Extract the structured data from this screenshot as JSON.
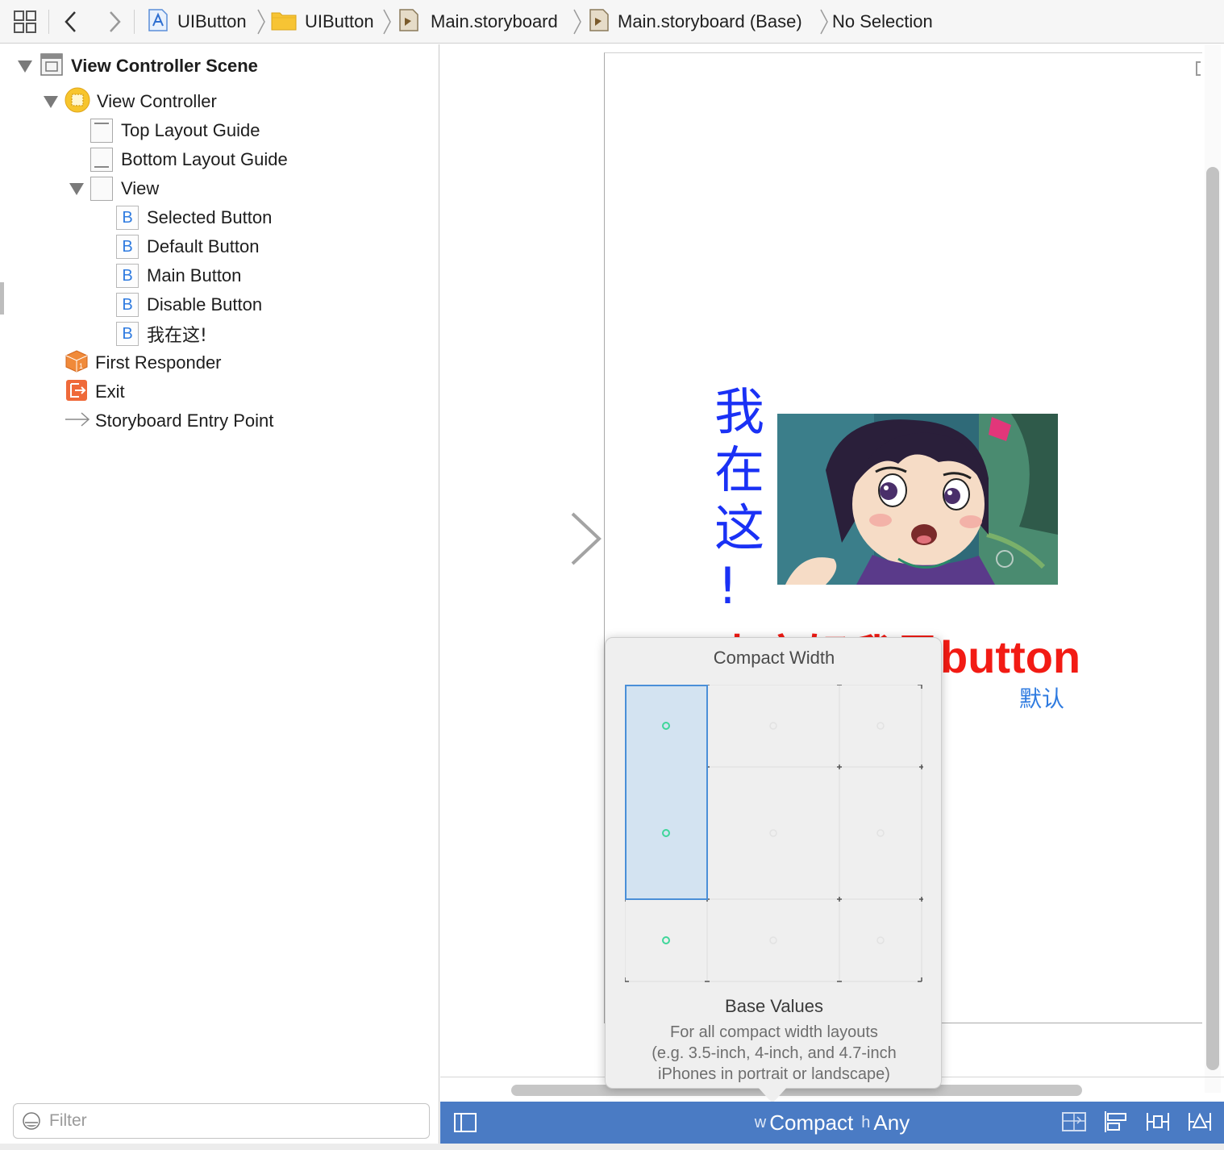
{
  "jumpbar": {
    "crumbs": [
      {
        "label": "UIButton",
        "icon": "app-project-icon"
      },
      {
        "label": "UIButton",
        "icon": "folder-icon"
      },
      {
        "label": "Main.storyboard",
        "icon": "storyboard-file-icon"
      },
      {
        "label": "Main.storyboard (Base)",
        "icon": "storyboard-file-icon"
      },
      {
        "label": "No Selection",
        "icon": ""
      }
    ]
  },
  "outline": {
    "scene": "View Controller Scene",
    "view_controller": "View Controller",
    "top_layout_guide": "Top Layout Guide",
    "bottom_layout_guide": "Bottom Layout Guide",
    "view": "View",
    "buttons": [
      "Selected Button",
      "Default Button",
      "Main Button",
      "Disable Button",
      "我在这!"
    ],
    "button_icon_letter": "B",
    "first_responder": "First Responder",
    "exit": "Exit",
    "entry_point": "Storyboard Entry Point",
    "filter_placeholder": "Filter"
  },
  "canvas": {
    "vertical_text": [
      "我",
      "在",
      "这",
      "!"
    ],
    "red_text": "大家好我是button",
    "default_text": "默认",
    "colors": {
      "blue_text": "#1a31f5",
      "red_text": "#f21b14",
      "system_blue": "#2f7be0"
    }
  },
  "popover": {
    "title": "Compact Width",
    "subtitle": "Base Values",
    "description": [
      "For all compact width layouts",
      "(e.g. 3.5-inch, 4-inch, and 4.7-inch",
      "iPhones in portrait or landscape)"
    ]
  },
  "bottombar": {
    "w_prefix": "w",
    "width_class": "Compact",
    "h_prefix": "h",
    "height_class": "Any",
    "color": "#4a7bc4"
  }
}
